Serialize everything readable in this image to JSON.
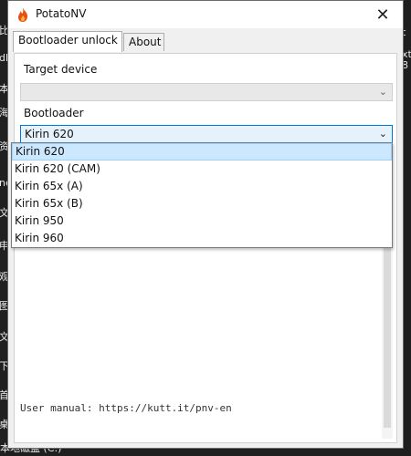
{
  "window": {
    "title": "PotatoNV",
    "close_glyph": "✕"
  },
  "tabs": [
    {
      "label": "Bootloader unlock"
    },
    {
      "label": "About"
    }
  ],
  "form": {
    "target_device_label": "Target device",
    "target_device_value": "",
    "bootloader_label": "Bootloader",
    "bootloader_value": "Kirin 620",
    "dropdown_arrow": "⌄"
  },
  "bootloader_options": [
    "Kirin 620",
    "Kirin 620 (CAM)",
    "Kirin 65x (A)",
    "Kirin 65x (B)",
    "Kirin 950",
    "Kirin 960"
  ],
  "log": {
    "line": "User manual: https://kutt.it/pnv-en"
  },
  "background": {
    "left_chars": [
      "比",
      "dl",
      "本",
      "海",
      "资",
      "ne",
      "文",
      "申",
      "观",
      "图",
      "文",
      "下",
      "首",
      "桌"
    ],
    "right_chars": [
      "t",
      "xt",
      "8"
    ],
    "bottom_text": "本地磁盘 (C:)"
  },
  "colors": {
    "accent": "#0078d7",
    "selected_bg": "#cce8ff",
    "app_icon": "#e8520f"
  },
  "icons": {
    "app": "flame-icon",
    "close": "close-icon",
    "combo": "chevron-down-icon"
  }
}
